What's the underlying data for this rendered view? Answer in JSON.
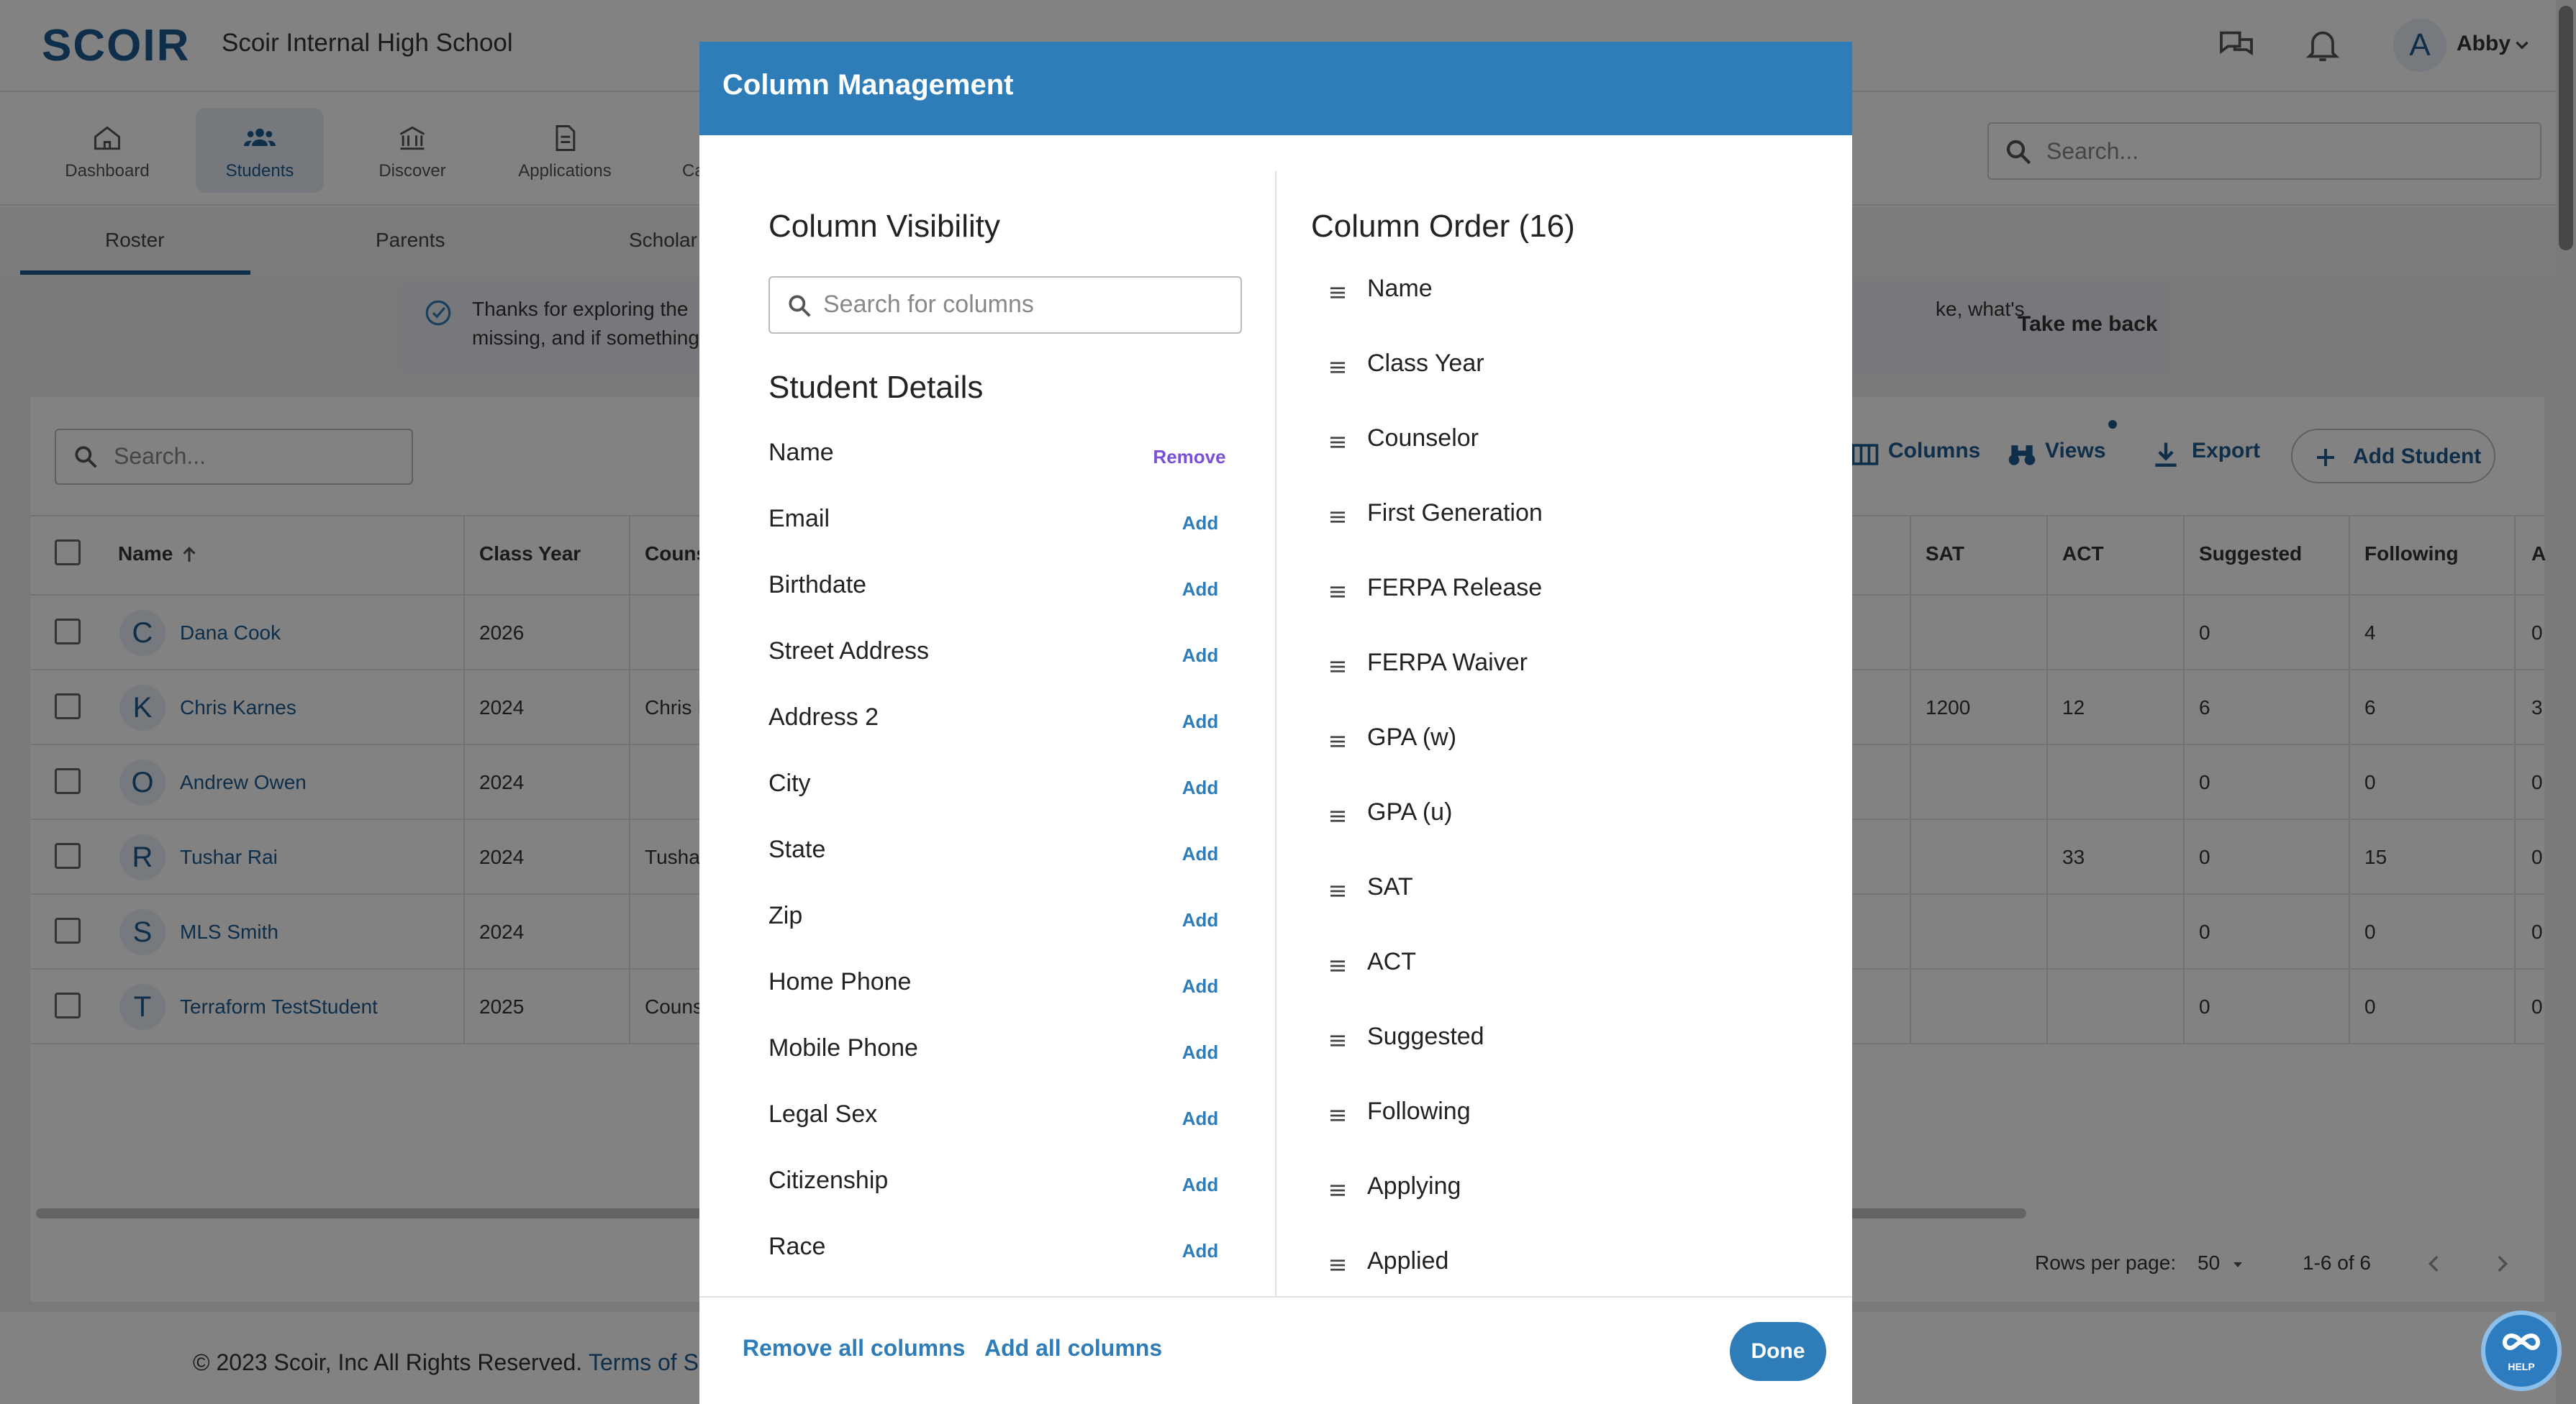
{
  "app": {
    "logo": "SCOIR",
    "school": "Scoir Internal High School",
    "user_initial": "A",
    "user_name": "Abby",
    "brand_color": "#1d5a8f",
    "modal_header_color": "#2f7db8"
  },
  "nav": {
    "items": [
      {
        "label": "Dashboard",
        "icon": "home-icon"
      },
      {
        "label": "Students",
        "icon": "students-icon",
        "active": true
      },
      {
        "label": "Discover",
        "icon": "institution-icon"
      },
      {
        "label": "Applications",
        "icon": "document-icon"
      },
      {
        "label": "Ca",
        "icon": "calendar-icon"
      }
    ],
    "search_placeholder": "Search..."
  },
  "subnav": {
    "tabs": [
      {
        "label": "Roster",
        "active": true
      },
      {
        "label": "Parents"
      },
      {
        "label": "Scholar"
      }
    ]
  },
  "banner": {
    "line1": "Thanks for exploring the",
    "line2": "missing, and if something",
    "line1_end": "ke, what's",
    "take_back": "Take me back"
  },
  "table": {
    "search_placeholder": "Search...",
    "toolbar": {
      "columns": "Columns",
      "views": "Views",
      "export": "Export",
      "add_student": "Add Student"
    },
    "headers": {
      "name": "Name",
      "class_year": "Class Year",
      "counselor": "Couns",
      "sat": "SAT",
      "act": "ACT",
      "suggested": "Suggested",
      "following": "Following",
      "applying": "A"
    },
    "rows": [
      {
        "initial": "C",
        "name": "Dana Cook",
        "year": "2026",
        "counselor": "",
        "sat": "",
        "act": "",
        "suggested": "0",
        "following": "4",
        "applying": "0"
      },
      {
        "initial": "K",
        "name": "Chris Karnes",
        "year": "2024",
        "counselor": "Chris I",
        "sat": "1200",
        "act": "12",
        "suggested": "6",
        "following": "6",
        "applying": "3"
      },
      {
        "initial": "O",
        "name": "Andrew Owen",
        "year": "2024",
        "counselor": "",
        "sat": "",
        "act": "",
        "suggested": "0",
        "following": "0",
        "applying": "0"
      },
      {
        "initial": "R",
        "name": "Tushar Rai",
        "year": "2024",
        "counselor": "Tusha",
        "sat": "",
        "act": "33",
        "suggested": "0",
        "following": "15",
        "applying": "0"
      },
      {
        "initial": "S",
        "name": "MLS Smith",
        "year": "2024",
        "counselor": "",
        "sat": "",
        "act": "",
        "suggested": "0",
        "following": "0",
        "applying": "0"
      },
      {
        "initial": "T",
        "name": "Terraform TestStudent",
        "year": "2025",
        "counselor": "Couns",
        "sat": "",
        "act": "",
        "suggested": "0",
        "following": "0",
        "applying": "0"
      }
    ],
    "pagination": {
      "rows_per_page_label": "Rows per page:",
      "rows_per_page": "50",
      "range": "1-6 of 6"
    }
  },
  "footer": {
    "copyright": "© 2023 Scoir, Inc All Rights Reserved.",
    "terms": "Terms of S",
    "help": "HELP"
  },
  "modal": {
    "title": "Column Management",
    "visibility_title": "Column Visibility",
    "search_placeholder": "Search for columns",
    "section_title": "Student Details",
    "visibility_items": [
      {
        "label": "Name",
        "action": "Remove"
      },
      {
        "label": "Email",
        "action": "Add"
      },
      {
        "label": "Birthdate",
        "action": "Add"
      },
      {
        "label": "Street Address",
        "action": "Add"
      },
      {
        "label": "Address 2",
        "action": "Add"
      },
      {
        "label": "City",
        "action": "Add"
      },
      {
        "label": "State",
        "action": "Add"
      },
      {
        "label": "Zip",
        "action": "Add"
      },
      {
        "label": "Home Phone",
        "action": "Add"
      },
      {
        "label": "Mobile Phone",
        "action": "Add"
      },
      {
        "label": "Legal Sex",
        "action": "Add"
      },
      {
        "label": "Citizenship",
        "action": "Add"
      },
      {
        "label": "Race",
        "action": "Add"
      }
    ],
    "order_title": "Column Order (16)",
    "order_items": [
      "Name",
      "Class Year",
      "Counselor",
      "First Generation",
      "FERPA Release",
      "FERPA Waiver",
      "GPA (w)",
      "GPA (u)",
      "SAT",
      "ACT",
      "Suggested",
      "Following",
      "Applying",
      "Applied"
    ],
    "remove_all": "Remove all columns",
    "add_all": "Add all columns",
    "done": "Done"
  }
}
